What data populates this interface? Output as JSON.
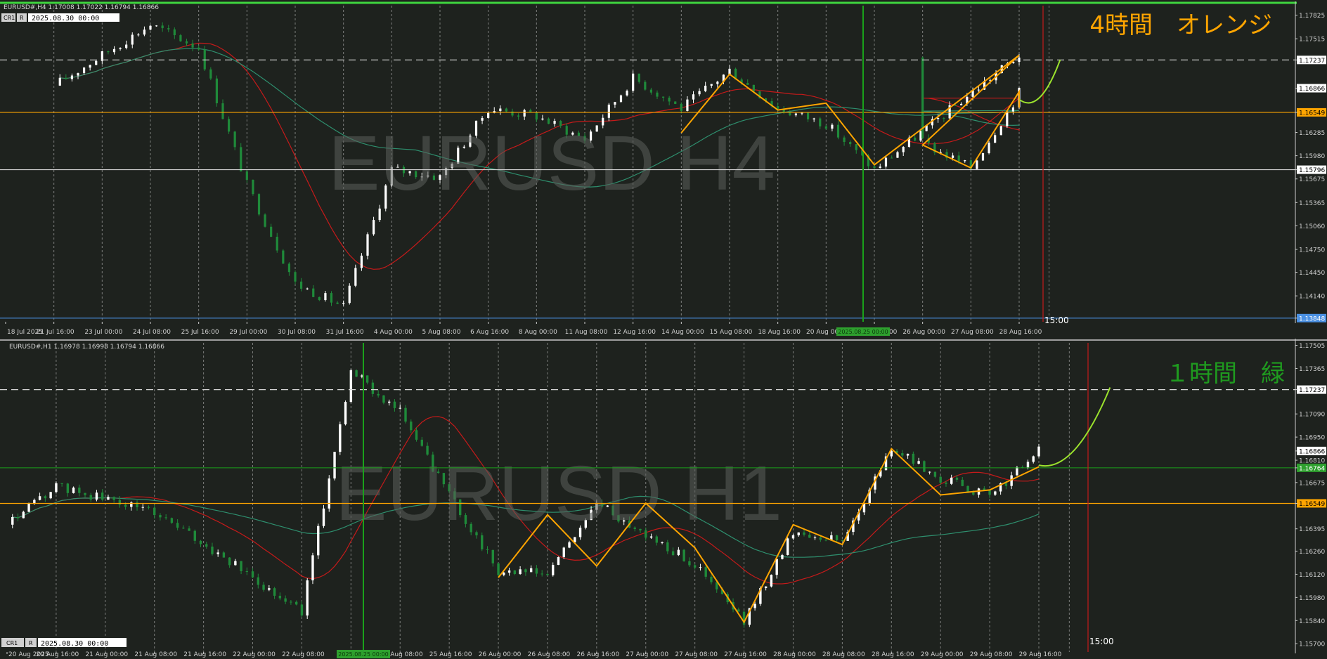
{
  "colors": {
    "background": "#1e221e",
    "grid": "#c8c8c8",
    "bull": "#ffffff",
    "bear": "#1f8a3a",
    "ma_red": "#c51a1a",
    "ma_teal": "#2e8f6e",
    "zigzag": "#ffa500",
    "projection": "#9be22d",
    "level_orange": "#ffa500",
    "level_white": "#d8d8d8",
    "vline_green": "#1aa11a",
    "vline_red": "#c51a1a",
    "label_orange_bg": "#ffa500",
    "label_green_bg": "#2ea02e",
    "watermark": "#5a5e5a"
  },
  "panels": [
    {
      "id": "h4",
      "header": "EURUSD#,H4  1.17008 1.17022 1.16794 1.16866",
      "cr1": "CR1",
      "r": "R",
      "date_input": "2025.08.30 00:00",
      "watermark": "EURUSD H4",
      "annotation": "4時間　オレンジ",
      "annotation_color": "#ffa500",
      "time_marker": "15:00",
      "price_labels": [
        "1.17825",
        "1.17515",
        "1.17237",
        "1.16866",
        "1.16549",
        "1.16285",
        "1.15980",
        "1.15796",
        "1.15675",
        "1.15365",
        "1.15060",
        "1.14750",
        "1.14450",
        "1.14140",
        "1.13848"
      ],
      "price_levels": {
        "dashed_white": "1.17237",
        "current": "1.16866",
        "orange": "1.16549",
        "white": "1.15796",
        "bottom": "1.13848"
      },
      "time_labels": [
        "18 Jul 2025",
        "21 Jul 16:00",
        "23 Jul 00:00",
        "24 Jul 08:00",
        "25 Jul 16:00",
        "29 Jul 00:00",
        "30 Jul 08:00",
        "31 Jul 16:00",
        "4 Aug 00:00",
        "5 Aug 08:00",
        "6 Aug 16:00",
        "8 Aug 00:00",
        "11 Aug 08:00",
        "12 Aug 16:00",
        "14 Aug 00:00",
        "15 Aug 08:00",
        "18 Aug 16:00",
        "20 Aug 00:00",
        "21 Aug 08:00",
        "26 Aug 00:00",
        "27 Aug 08:00",
        "28 Aug 16:00"
      ],
      "highlight_time": "2025.08.25 00:00"
    },
    {
      "id": "h1",
      "header": "EURUSD#,H1  1.16978 1.16998 1.16794 1.16866",
      "cr1": "CR1",
      "r": "R",
      "date_input": "2025.08.30 00:00",
      "watermark": "EURUSD H1",
      "annotation": "１時間　緑",
      "annotation_color": "#1f9a1f",
      "time_marker": "15:00",
      "price_labels": [
        "1.17505",
        "1.17365",
        "1.17237",
        "1.17090",
        "1.16950",
        "1.16866",
        "1.16810",
        "1.16764",
        "1.16675",
        "1.16549",
        "1.16395",
        "1.16260",
        "1.16120",
        "1.15980",
        "1.15840",
        "1.15700"
      ],
      "price_levels": {
        "dashed_white": "1.17237",
        "current": "1.16866",
        "green": "1.16764",
        "orange": "1.16549"
      },
      "time_labels": [
        "20 Aug 2025",
        "20 Aug 16:00",
        "21 Aug 00:00",
        "21 Aug 08:00",
        "21 Aug 16:00",
        "22 Aug 00:00",
        "22 Aug 08:00",
        "22 Au",
        "25 Aug 08:00",
        "25 Aug 16:00",
        "26 Aug 00:00",
        "26 Aug 08:00",
        "26 Aug 16:00",
        "27 Aug 00:00",
        "27 Aug 08:00",
        "27 Aug 16:00",
        "28 Aug 00:00",
        "28 Aug 08:00",
        "28 Aug 16:00",
        "29 Aug 00:00",
        "29 Aug 08:00",
        "29 Aug 16:00"
      ],
      "highlight_time": "2025.08.25 00:00"
    }
  ],
  "chart_data": [
    {
      "type": "candlestick",
      "title": "EURUSD#,H4",
      "ylim": [
        1.138,
        1.1795
      ],
      "x_range": [
        "18 Jul 2025",
        "29 Aug 16:00"
      ],
      "grid": true,
      "key_points": [
        {
          "x": "21 Jul 16:00",
          "y": 1.169
        },
        {
          "x": "24 Jul 08:00",
          "y": 1.177
        },
        {
          "x": "25 Jul 16:00",
          "y": 1.174
        },
        {
          "x": "29 Jul 00:00",
          "y": 1.156
        },
        {
          "x": "30 Jul 08:00",
          "y": 1.143
        },
        {
          "x": "31 Jul 16:00",
          "y": 1.14
        },
        {
          "x": "4 Aug 00:00",
          "y": 1.158
        },
        {
          "x": "5 Aug 08:00",
          "y": 1.157
        },
        {
          "x": "6 Aug 16:00",
          "y": 1.166
        },
        {
          "x": "8 Aug 00:00",
          "y": 1.165
        },
        {
          "x": "11 Aug 08:00",
          "y": 1.162
        },
        {
          "x": "12 Aug 16:00",
          "y": 1.17
        },
        {
          "x": "14 Aug 00:00",
          "y": 1.166
        },
        {
          "x": "15 Aug 08:00",
          "y": 1.171
        },
        {
          "x": "18 Aug 16:00",
          "y": 1.166
        },
        {
          "x": "20 Aug 00:00",
          "y": 1.164
        },
        {
          "x": "21 Aug 08:00",
          "y": 1.158
        },
        {
          "x": "22 Aug 16:00",
          "y": 1.173
        },
        {
          "x": "26 Aug 00:00",
          "y": 1.1615
        },
        {
          "x": "27 Aug 08:00",
          "y": 1.1582
        },
        {
          "x": "28 Aug 16:00",
          "y": 1.168
        },
        {
          "x": "29 Aug 16:00",
          "y": 1.1686
        }
      ],
      "zigzag_orange": [
        {
          "x": "14 Aug 00:00",
          "y": 1.1628
        },
        {
          "x": "15 Aug 08:00",
          "y": 1.1705
        },
        {
          "x": "18 Aug 16:00",
          "y": 1.1658
        },
        {
          "x": "20 Aug 00:00",
          "y": 1.1667
        },
        {
          "x": "21 Aug 08:00",
          "y": 1.1586
        },
        {
          "x": "22 Aug 16:00",
          "y": 1.173
        },
        {
          "x": "26 Aug 00:00",
          "y": 1.1612
        },
        {
          "x": "27 Aug 08:00",
          "y": 1.1582
        },
        {
          "x": "28 Aug 16:00",
          "y": 1.1682
        },
        {
          "x": "29 Aug 16:00",
          "y": 1.1661
        }
      ],
      "projection": [
        {
          "x": "29 Aug 08:00",
          "y": 1.1672
        },
        {
          "x": "29 Aug 16:00",
          "y": 1.1662
        },
        {
          "x": "1 Sep 00:00",
          "y": 1.1724
        }
      ],
      "levels": [
        1.17237,
        1.16866,
        1.16549,
        1.15796,
        1.13848
      ]
    },
    {
      "type": "candlestick",
      "title": "EURUSD#,H1",
      "ylim": [
        1.1565,
        1.1752
      ],
      "x_range": [
        "20 Aug 2025",
        "29 Aug 16:00"
      ],
      "grid": true,
      "key_points": [
        {
          "x": "20 Aug 2025",
          "y": 1.1642
        },
        {
          "x": "20 Aug 16:00",
          "y": 1.1665
        },
        {
          "x": "21 Aug 08:00",
          "y": 1.165
        },
        {
          "x": "22 Aug 00:00",
          "y": 1.161
        },
        {
          "x": "22 Aug 08:00",
          "y": 1.159
        },
        {
          "x": "22 Au",
          "y": 1.1735
        },
        {
          "x": "25 Aug 08:00",
          "y": 1.171
        },
        {
          "x": "25 Aug 16:00",
          "y": 1.166
        },
        {
          "x": "26 Aug 00:00",
          "y": 1.1614
        },
        {
          "x": "26 Aug 08:00",
          "y": 1.1612
        },
        {
          "x": "26 Aug 16:00",
          "y": 1.1655
        },
        {
          "x": "27 Aug 00:00",
          "y": 1.1636
        },
        {
          "x": "27 Aug 08:00",
          "y": 1.1618
        },
        {
          "x": "27 Aug 16:00",
          "y": 1.1583
        },
        {
          "x": "28 Aug 00:00",
          "y": 1.1638
        },
        {
          "x": "28 Aug 08:00",
          "y": 1.1632
        },
        {
          "x": "28 Aug 16:00",
          "y": 1.1688
        },
        {
          "x": "29 Aug 00:00",
          "y": 1.167
        },
        {
          "x": "29 Aug 08:00",
          "y": 1.1659
        },
        {
          "x": "29 Aug 16:00",
          "y": 1.1687
        }
      ],
      "zigzag_orange": [
        {
          "x": "26 Aug 00:00",
          "y": 1.161
        },
        {
          "x": "26 Aug 08:00",
          "y": 1.1648
        },
        {
          "x": "26 Aug 16:00",
          "y": 1.1617
        },
        {
          "x": "27 Aug 00:00",
          "y": 1.1655
        },
        {
          "x": "27 Aug 08:00",
          "y": 1.1628
        },
        {
          "x": "27 Aug 16:00",
          "y": 1.1583
        },
        {
          "x": "28 Aug 00:00",
          "y": 1.1642
        },
        {
          "x": "28 Aug 08:00",
          "y": 1.163
        },
        {
          "x": "28 Aug 16:00",
          "y": 1.1688
        },
        {
          "x": "29 Aug 00:00",
          "y": 1.166
        },
        {
          "x": "29 Aug 08:00",
          "y": 1.1663
        },
        {
          "x": "29 Aug 16:00",
          "y": 1.1677
        }
      ],
      "projection": [
        {
          "x": "29 Aug 16:00",
          "y": 1.1678
        },
        {
          "x": "1 Sep 00:00",
          "y": 1.168
        },
        {
          "x": "1 Sep 08:00",
          "y": 1.1725
        }
      ],
      "levels": [
        1.17237,
        1.16866,
        1.16764,
        1.16549
      ]
    }
  ]
}
